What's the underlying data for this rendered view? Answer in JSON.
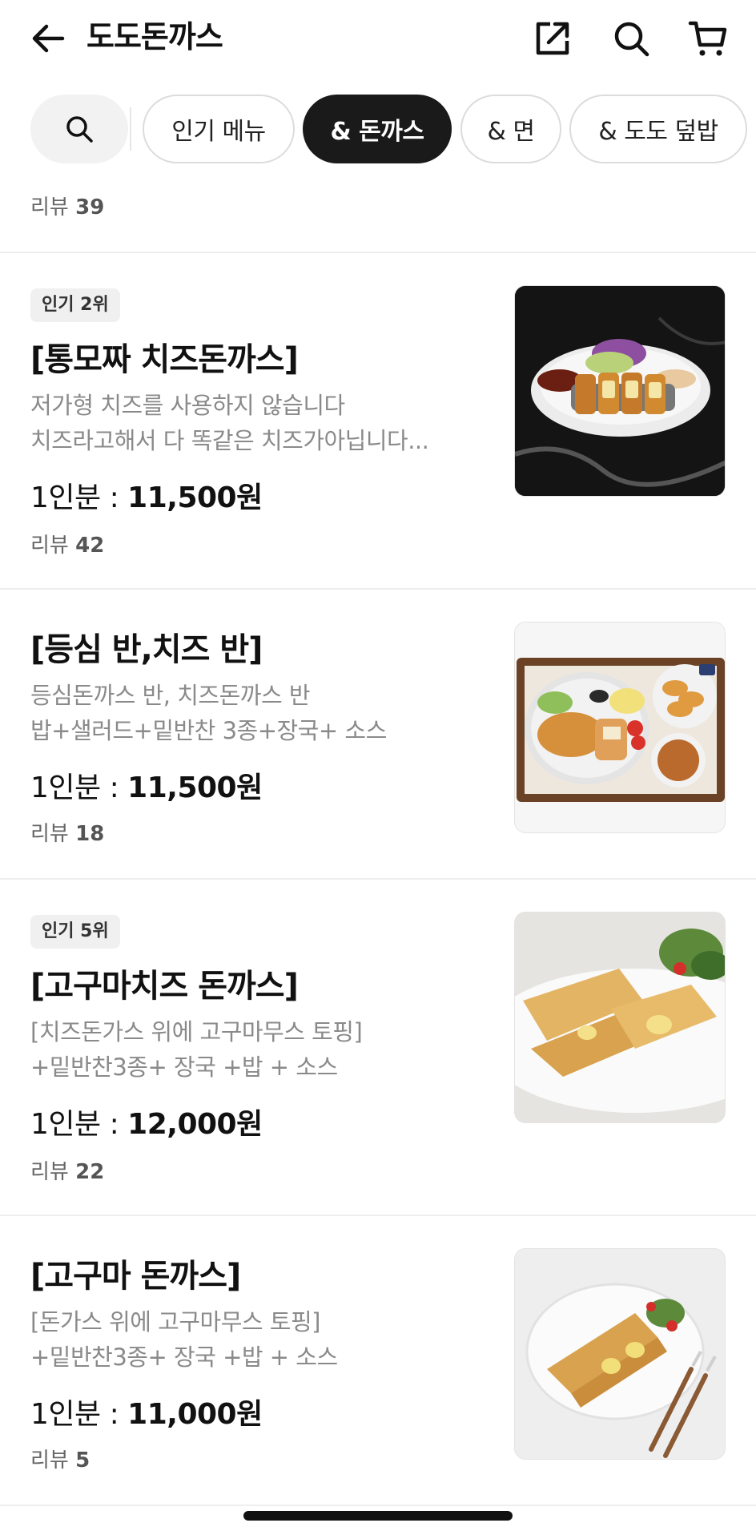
{
  "header": {
    "title": "도도돈까스",
    "back_icon": "arrow-left-icon",
    "share_icon": "share-icon",
    "search_icon": "search-icon",
    "cart_icon": "cart-icon"
  },
  "categories": {
    "search_icon": "search-icon",
    "items": [
      {
        "label": "인기 메뉴",
        "active": false
      },
      {
        "label": "& 돈까스",
        "active": true
      },
      {
        "label": "& 면",
        "active": false
      },
      {
        "label": "& 도도 덮밥",
        "active": false
      }
    ]
  },
  "partial_item": {
    "review_label": "리뷰",
    "review_count": "39"
  },
  "menu_items": [
    {
      "badge": "인기 2위",
      "name": "[통모짜 치즈돈까스]",
      "desc_line1": "저가형 치즈를 사용하지 않습니다",
      "desc_line2": "치즈라고해서 다 똑같은 치즈가아닙니다...",
      "price_label": "1인분 : ",
      "price": "11,500원",
      "review_label": "리뷰",
      "review_count": "42"
    },
    {
      "badge": "",
      "name": "[등심 반,치즈 반]",
      "desc_line1": "등심돈까스 반, 치즈돈까스 반",
      "desc_line2": "밥+샐러드+밑반찬 3종+장국+ 소스",
      "price_label": "1인분 : ",
      "price": "11,500원",
      "review_label": "리뷰",
      "review_count": "18"
    },
    {
      "badge": "인기 5위",
      "name": "[고구마치즈 돈까스]",
      "desc_line1": "[치즈돈가스 위에 고구마무스 토핑]",
      "desc_line2": "+밑반찬3종+ 장국 +밥 + 소스",
      "price_label": "1인분 : ",
      "price": "12,000원",
      "review_label": "리뷰",
      "review_count": "22"
    },
    {
      "badge": "",
      "name": "[고구마 돈까스]",
      "desc_line1": "[돈가스 위에 고구마무스 토핑]",
      "desc_line2": "+밑반찬3종+ 장국 +밥 + 소스",
      "price_label": "1인분 : ",
      "price": "11,000원",
      "review_label": "리뷰",
      "review_count": "5"
    }
  ]
}
